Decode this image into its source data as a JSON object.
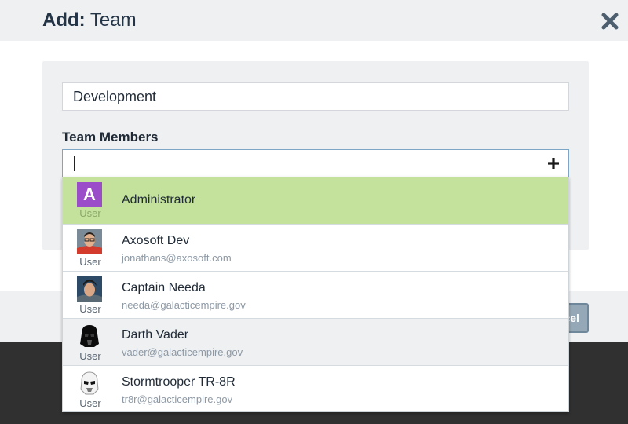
{
  "dialog": {
    "title_prefix": "Add:",
    "title_rest": " Team"
  },
  "form": {
    "team_name_value": "Development",
    "members_label": "Team Members",
    "member_search_value": ""
  },
  "footer": {
    "cancel_label": "Cancel"
  },
  "colors": {
    "selected_row": "#c5e29c",
    "hover_row": "#eef0f2",
    "admin_avatar": "#9b4dc9",
    "title_text": "#243447"
  },
  "dropdown": {
    "options": [
      {
        "name": "Administrator",
        "email": "",
        "type": "User",
        "avatar_letter": "A",
        "avatar_icon": "letter-avatar"
      },
      {
        "name": "Axosoft Dev",
        "email": "jonathans@axosoft.com",
        "type": "User",
        "avatar_icon": "person-photo"
      },
      {
        "name": "Captain Needa",
        "email": "needa@galacticempire.gov",
        "type": "User",
        "avatar_icon": "person-photo"
      },
      {
        "name": "Darth Vader",
        "email": "vader@galacticempire.gov",
        "type": "User",
        "avatar_icon": "vader-helmet"
      },
      {
        "name": "Stormtrooper TR-8R",
        "email": "tr8r@galacticempire.gov",
        "type": "User",
        "avatar_icon": "stormtrooper-helmet"
      }
    ]
  }
}
